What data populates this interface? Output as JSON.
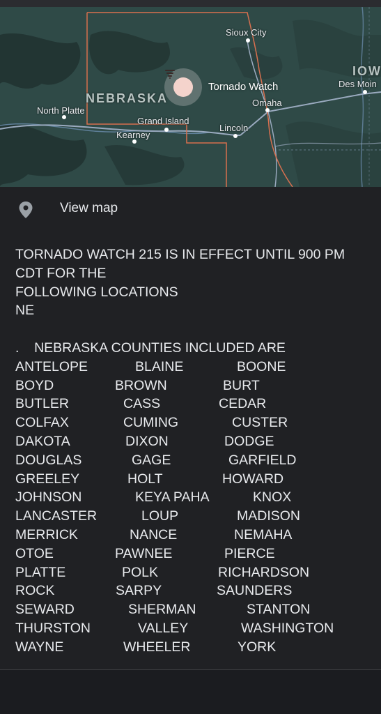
{
  "map": {
    "state_labels": {
      "nebraska": "NEBRASKA",
      "iowa": "IOW"
    },
    "cities": {
      "sioux_city": "Sioux City",
      "des_moines": "Des Moin",
      "omaha": "Omaha",
      "north_platte": "North Platte",
      "grand_island": "Grand Island",
      "kearney": "Kearney",
      "lincoln": "Lincoln"
    },
    "pin_title": "Tornado Watch",
    "pin_icon": "tornado-icon",
    "colors": {
      "land": "#2f4a47",
      "border": "#d9704f",
      "roads": "#8aa0b8"
    }
  },
  "view_map": {
    "label": "View map",
    "icon": "location-pin-icon"
  },
  "alert": {
    "line1": "TORNADO WATCH 215 IS IN EFFECT UNTIL 900 PM",
    "line2": "CDT FOR THE",
    "line3": "FOLLOWING LOCATIONS",
    "line4": "NE",
    "counties_heading": ".    NEBRASKA COUNTIES INCLUDED ARE",
    "counties": [
      [
        "ANTELOPE",
        "BLAINE",
        "BOONE"
      ],
      [
        "BOYD",
        "BROWN",
        "BURT"
      ],
      [
        "BUTLER",
        "CASS",
        "CEDAR"
      ],
      [
        "COLFAX",
        "CUMING",
        "CUSTER"
      ],
      [
        "DAKOTA",
        "DIXON",
        "DODGE"
      ],
      [
        "DOUGLAS",
        "GAGE",
        "GARFIELD"
      ],
      [
        "GREELEY",
        "HOLT",
        "HOWARD"
      ],
      [
        "JOHNSON",
        "KEYA PAHA",
        "KNOX"
      ],
      [
        "LANCASTER",
        "LOUP",
        "MADISON"
      ],
      [
        "MERRICK",
        "NANCE",
        "NEMAHA"
      ],
      [
        "OTOE",
        "PAWNEE",
        "PIERCE"
      ],
      [
        "PLATTE",
        "POLK",
        "RICHARDSON"
      ],
      [
        "ROCK",
        "SARPY",
        "SAUNDERS"
      ],
      [
        "SEWARD",
        "SHERMAN",
        "STANTON"
      ],
      [
        "THURSTON",
        "VALLEY",
        "WASHINGTON"
      ],
      [
        "WAYNE",
        "WHEELER",
        "YORK"
      ]
    ]
  }
}
